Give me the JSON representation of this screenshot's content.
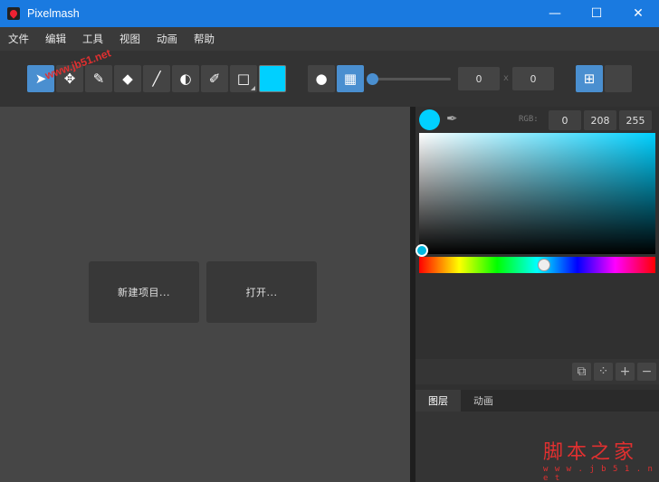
{
  "window": {
    "title": "Pixelmash",
    "minimize": "—",
    "maximize": "☐",
    "close": "✕"
  },
  "menu": [
    "文件",
    "编辑",
    "工具",
    "视图",
    "动画",
    "帮助"
  ],
  "toolbar": {
    "tools": [
      {
        "name": "select-tool",
        "icon": "arrow-icon",
        "glyph": "➤"
      },
      {
        "name": "move-tool",
        "icon": "move-icon",
        "glyph": "✥"
      },
      {
        "name": "pencil-tool",
        "icon": "pencil-icon",
        "glyph": "✎"
      },
      {
        "name": "eraser-tool",
        "icon": "eraser-icon",
        "glyph": "◆"
      },
      {
        "name": "line-tool",
        "icon": "line-icon",
        "glyph": "╱"
      },
      {
        "name": "fill-tool",
        "icon": "contrast-icon",
        "glyph": "◐"
      },
      {
        "name": "brush-tool",
        "icon": "brush-icon",
        "glyph": "✐"
      },
      {
        "name": "rectangle-tool",
        "icon": "square-icon",
        "glyph": "□"
      }
    ],
    "color": "#00d0ff",
    "shape_buttons": [
      {
        "name": "circle-brush-button",
        "glyph": "●"
      },
      {
        "name": "checker-brush-button",
        "glyph": "▦"
      }
    ],
    "x_value": "0",
    "separator": "x",
    "y_value": "0"
  },
  "canvas": {
    "new_project": "新建项目...",
    "open": "打开..."
  },
  "color_panel": {
    "rgb_label": "RGB:",
    "r": "0",
    "g": "208",
    "b": "255"
  },
  "layers": {
    "tabs": [
      "图层",
      "动画"
    ],
    "buttons": [
      "⧉",
      "⁘",
      "+",
      "−"
    ]
  },
  "watermark": {
    "site": "www.jb51.net",
    "brand": "脚本之家",
    "url": "w w w . j b 5 1 . n e t"
  }
}
